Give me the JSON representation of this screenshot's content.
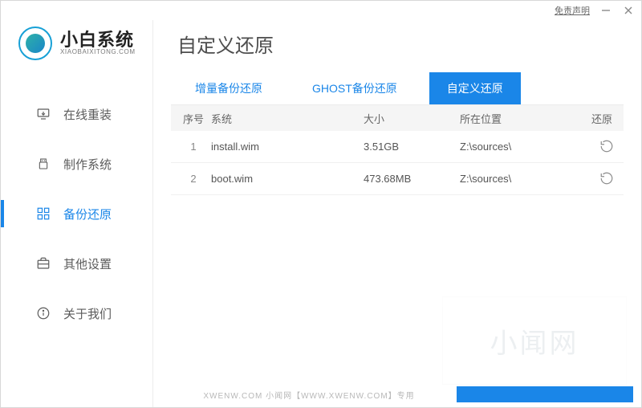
{
  "titlebar": {
    "disclaimer": "免责声明"
  },
  "brand": {
    "name": "小白系统",
    "sub": "XIAOBAIXITONG.COM"
  },
  "sidebar": {
    "items": [
      {
        "label": "在线重装",
        "icon": "monitor-download-icon",
        "active": false
      },
      {
        "label": "制作系统",
        "icon": "usb-icon",
        "active": false
      },
      {
        "label": "备份还原",
        "icon": "grid-icon",
        "active": true
      },
      {
        "label": "其他设置",
        "icon": "briefcase-icon",
        "active": false
      },
      {
        "label": "关于我们",
        "icon": "info-icon",
        "active": false
      }
    ]
  },
  "main": {
    "title": "自定义还原",
    "tabs": [
      {
        "label": "增量备份还原",
        "active": false
      },
      {
        "label": "GHOST备份还原",
        "active": false
      },
      {
        "label": "自定义还原",
        "active": true
      }
    ],
    "columns": {
      "index": "序号",
      "system": "系统",
      "size": "大小",
      "location": "所在位置",
      "restore": "还原"
    },
    "rows": [
      {
        "index": "1",
        "system": "install.wim",
        "size": "3.51GB",
        "location": "Z:\\sources\\"
      },
      {
        "index": "2",
        "system": "boot.wim",
        "size": "473.68MB",
        "location": "Z:\\sources\\"
      }
    ]
  },
  "watermark": "小闻网",
  "footnote": "XWENW.COM   小闻网【WWW.XWENW.COM】专用"
}
